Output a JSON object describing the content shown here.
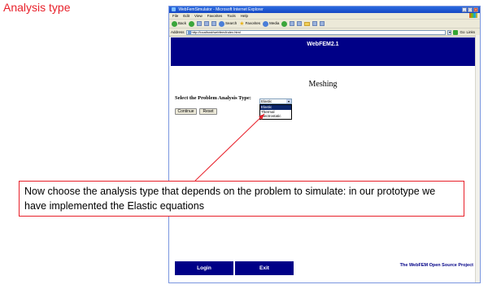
{
  "slide": {
    "title": "Analysis type"
  },
  "browser": {
    "window_title": "WebFemSimulator - Microsoft Internet Explorer",
    "menu": [
      "File",
      "Edit",
      "View",
      "Favorites",
      "Tools",
      "Help"
    ],
    "toolbar": {
      "back_label": "Back",
      "search_label": "Search",
      "favorites_label": "Favorites",
      "media_label": "Media"
    },
    "address_label": "Address",
    "address_value": "http://localhost/webfem/index.html",
    "go_label": "Go",
    "links_label": "Links"
  },
  "page": {
    "header_title": "WebFEM2.1",
    "heading": "Meshing",
    "select_label": "Select the Problem Analysis Type:",
    "select_value": "Elastic",
    "options": [
      "Elastic",
      "Thermal",
      "Electrostatic"
    ],
    "selected_option": "Elastic",
    "continue_label": "Continue",
    "reset_label": "Reset",
    "footer": {
      "login_label": "Login",
      "exit_label": "Exit",
      "project_note": "The WebFEM Open Source Project"
    }
  },
  "annotation": {
    "text": "Now choose the analysis type that depends on the problem to simulate: in our prototype we have implemented the Elastic equations"
  },
  "colors": {
    "accent_red": "#e8202a",
    "header_navy": "#000087",
    "xp_titlebar": "#1648c4"
  }
}
